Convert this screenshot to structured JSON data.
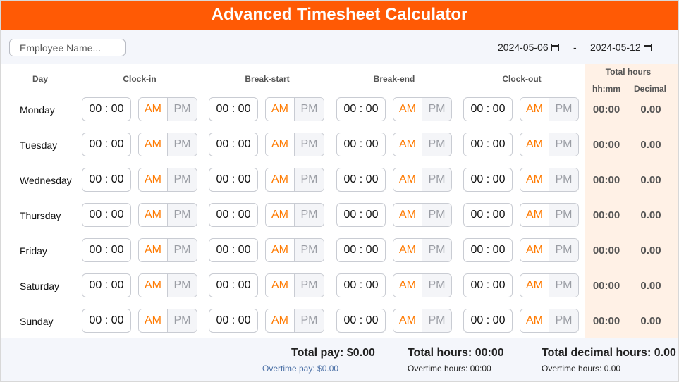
{
  "title": "Advanced Timesheet Calculator",
  "employee": {
    "placeholder": "Employee Name...",
    "value": ""
  },
  "date_range": {
    "start": "2024-05-06",
    "separator": "-",
    "end": "2024-05-12",
    "calendar_icon": "calendar-icon"
  },
  "headers": {
    "day": "Day",
    "clock_in": "Clock-in",
    "break_start": "Break-start",
    "break_end": "Break-end",
    "clock_out": "Clock-out",
    "total_hours": "Total hours",
    "hhmm": "hh:mm",
    "decimal": "Decimal"
  },
  "ampm_labels": {
    "am": "AM",
    "pm": "PM"
  },
  "colors": {
    "accent": "#ff5a05",
    "am_active": "#ff7a00",
    "total_bg": "#fff1e6"
  },
  "rows": [
    {
      "day": "Monday",
      "clock_in": "00 : 00",
      "break_start": "00 : 00",
      "break_end": "00 : 00",
      "clock_out": "00 : 00",
      "total_hhmm": "00:00",
      "total_decimal": "0.00"
    },
    {
      "day": "Tuesday",
      "clock_in": "00 : 00",
      "break_start": "00 : 00",
      "break_end": "00 : 00",
      "clock_out": "00 : 00",
      "total_hhmm": "00:00",
      "total_decimal": "0.00"
    },
    {
      "day": "Wednesday",
      "clock_in": "00 : 00",
      "break_start": "00 : 00",
      "break_end": "00 : 00",
      "clock_out": "00 : 00",
      "total_hhmm": "00:00",
      "total_decimal": "0.00"
    },
    {
      "day": "Thursday",
      "clock_in": "00 : 00",
      "break_start": "00 : 00",
      "break_end": "00 : 00",
      "clock_out": "00 : 00",
      "total_hhmm": "00:00",
      "total_decimal": "0.00"
    },
    {
      "day": "Friday",
      "clock_in": "00 : 00",
      "break_start": "00 : 00",
      "break_end": "00 : 00",
      "clock_out": "00 : 00",
      "total_hhmm": "00:00",
      "total_decimal": "0.00"
    },
    {
      "day": "Saturday",
      "clock_in": "00 : 00",
      "break_start": "00 : 00",
      "break_end": "00 : 00",
      "clock_out": "00 : 00",
      "total_hhmm": "00:00",
      "total_decimal": "0.00"
    },
    {
      "day": "Sunday",
      "clock_in": "00 : 00",
      "break_start": "00 : 00",
      "break_end": "00 : 00",
      "clock_out": "00 : 00",
      "total_hhmm": "00:00",
      "total_decimal": "0.00"
    }
  ],
  "footer": {
    "total_pay": "Total pay: $0.00",
    "overtime_pay": "Overtime pay: $0.00",
    "total_hours": "Total hours: 00:00",
    "overtime_hours": "Overtime hours: 00:00",
    "total_decimal_hours": "Total decimal hours: 0.00",
    "overtime_decimal_hours": "Overtime hours: 0.00"
  }
}
